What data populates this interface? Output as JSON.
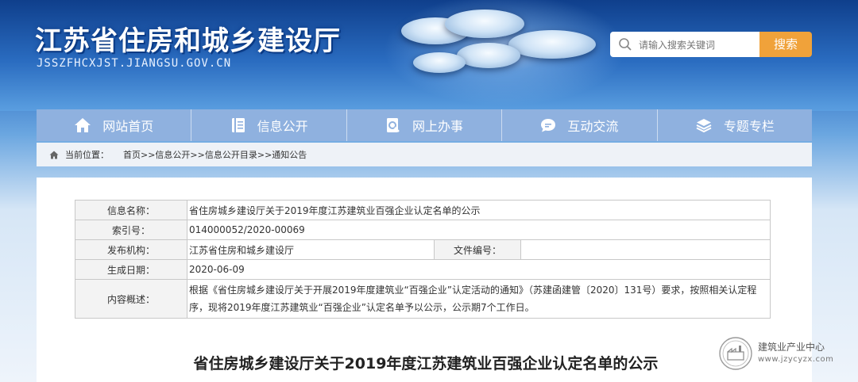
{
  "header": {
    "site_title": "江苏省住房和城乡建设厅",
    "site_url": "JSSZFHCXJST.JIANGSU.GOV.CN",
    "search_placeholder": "请输入搜索关键词",
    "search_button": "搜索",
    "accent_color": "#f0a23a"
  },
  "nav": {
    "items": [
      {
        "label": "网站首页",
        "icon": "home-icon"
      },
      {
        "label": "信息公开",
        "icon": "document-icon"
      },
      {
        "label": "网上办事",
        "icon": "search-doc-icon"
      },
      {
        "label": "互动交流",
        "icon": "chat-icon"
      },
      {
        "label": "专题专栏",
        "icon": "layers-icon"
      }
    ]
  },
  "breadcrumb": {
    "prefix": "当前位置：",
    "path": "首页>>信息公开>>信息公开目录>>通知公告"
  },
  "info_table": {
    "name_label": "信息名称：",
    "name_value": "省住房城乡建设厅关于2019年度江苏建筑业百强企业认定名单的公示",
    "index_label": "索引号：",
    "index_value": "014000052/2020-00069",
    "org_label": "发布机构：",
    "org_value": "江苏省住房和城乡建设厅",
    "docno_label": "文件编号：",
    "docno_value": "",
    "date_label": "生成日期：",
    "date_value": "2020-06-09",
    "summary_label": "内容概述：",
    "summary_value": "根据《省住房城乡建设厅关于开展2019年度建筑业“百强企业”认定活动的通知》（苏建函建管〔2020〕131号）要求，按照相关认定程序，现将2019年度江苏建筑业“百强企业”认定名单予以公示，公示期7个工作日。"
  },
  "article": {
    "title": "省住房城乡建设厅关于2019年度江苏建筑业百强企业认定名单的公示"
  },
  "watermark": {
    "name": "建筑业产业中心",
    "url": "www.jzycyzx.com"
  }
}
